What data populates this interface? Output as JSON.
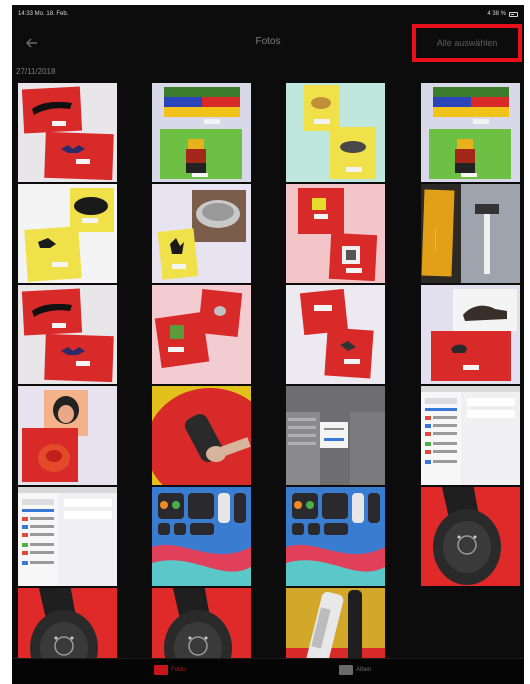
{
  "status_bar": {
    "time_date": "14:33  Mo. 18. Feb.",
    "battery": "4 38 %"
  },
  "nav": {
    "back_icon": "back-arrow-icon",
    "title": "Fotos",
    "select_all_label": "Alle auswählen",
    "highlight_color": "#e8101a"
  },
  "section": {
    "date": "27/11/2018"
  },
  "photos": [
    {
      "name": "photo-red-cards-pencil",
      "scene": "red-cards-white"
    },
    {
      "name": "photo-lego-figure",
      "scene": "lego"
    },
    {
      "name": "photo-yellow-cards-mint",
      "scene": "yellow-mint"
    },
    {
      "name": "photo-lego-figure-2",
      "scene": "lego"
    },
    {
      "name": "photo-yellow-cards-black",
      "scene": "yellow-white"
    },
    {
      "name": "photo-bowl-yellow-card",
      "scene": "bowl"
    },
    {
      "name": "photo-red-cards-pink",
      "scene": "red-pink"
    },
    {
      "name": "photo-hammer-card",
      "scene": "hammer"
    },
    {
      "name": "photo-red-cards-pencil-2",
      "scene": "red-cards-white"
    },
    {
      "name": "photo-red-cards-pink-2",
      "scene": "red-pink2"
    },
    {
      "name": "photo-red-cards-grid",
      "scene": "red-grid"
    },
    {
      "name": "photo-shoe-cards",
      "scene": "shoe"
    },
    {
      "name": "photo-face-button",
      "scene": "face"
    },
    {
      "name": "photo-red-button-hand",
      "scene": "red-hand"
    },
    {
      "name": "photo-ipad-settings-dialog",
      "scene": "settings-dialog"
    },
    {
      "name": "photo-ipad-settings",
      "scene": "settings"
    },
    {
      "name": "photo-ipad-settings-2",
      "scene": "settings"
    },
    {
      "name": "photo-ipad-control-center",
      "scene": "control-center"
    },
    {
      "name": "photo-ipad-control-center-2",
      "scene": "control-center"
    },
    {
      "name": "photo-remote-closeup",
      "scene": "remote"
    },
    {
      "name": "photo-remote-red",
      "scene": "remote"
    },
    {
      "name": "photo-remote-red-2",
      "scene": "remote"
    },
    {
      "name": "photo-white-device",
      "scene": "white-device"
    }
  ],
  "tabs": [
    {
      "label": "Fotos",
      "icon": "photos-icon",
      "color": "#c7141d",
      "active": true
    },
    {
      "label": "Alben",
      "icon": "albums-icon",
      "color": "#6a6a6a",
      "active": false
    }
  ]
}
